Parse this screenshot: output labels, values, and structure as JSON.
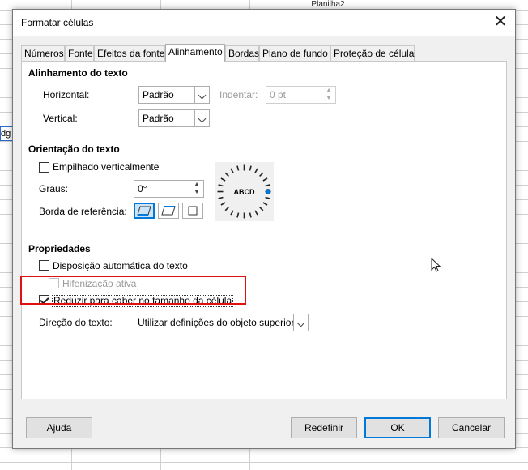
{
  "background": {
    "sheet_tab_fragment": "Planilha2",
    "cell_fragment": "dg c"
  },
  "dialog": {
    "title": "Formatar células",
    "close_glyph": "✕"
  },
  "tabs": [
    {
      "label": "Números",
      "active": false
    },
    {
      "label": "Fonte",
      "active": false
    },
    {
      "label": "Efeitos da fonte",
      "active": false
    },
    {
      "label": "Alinhamento",
      "active": true
    },
    {
      "label": "Bordas",
      "active": false
    },
    {
      "label": "Plano de fundo",
      "active": false
    },
    {
      "label": "Proteção de célula",
      "active": false
    }
  ],
  "alignment": {
    "section_title": "Alinhamento do texto",
    "horizontal_label": "Horizontal:",
    "horizontal_value": "Padrão",
    "indent_label": "Indentar:",
    "indent_value": "0 pt",
    "vertical_label": "Vertical:",
    "vertical_value": "Padrão"
  },
  "orientation": {
    "section_title": "Orientação do texto",
    "stacked_label": "Empilhado verticalmente",
    "degrees_label": "Graus:",
    "degrees_value": "0°",
    "reference_edge_label": "Borda de referência:",
    "dial_text": "ABCD"
  },
  "properties": {
    "section_title": "Propriedades",
    "wrap_label": "Disposição automática do texto",
    "hyphenation_label": "Hifenização ativa",
    "shrink_label": "Reduzir para caber no tamanho da célula",
    "direction_label": "Direção do texto:",
    "direction_value": "Utilizar definições do objeto superior"
  },
  "buttons": {
    "help": "Ajuda",
    "reset": "Redefinir",
    "ok": "OK",
    "cancel": "Cancelar"
  },
  "colors": {
    "annotation_red": "#e01010",
    "accent_blue": "#0078d7"
  }
}
